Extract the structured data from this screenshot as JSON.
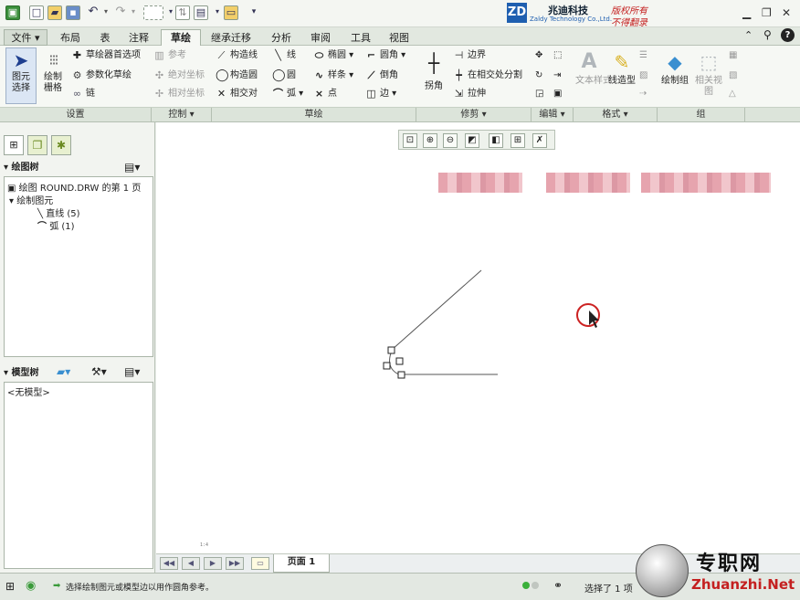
{
  "quick_access": {
    "icons": [
      "app-icon",
      "new-icon",
      "open-icon",
      "save-icon",
      "undo-icon",
      "redo-icon",
      "select-box-icon",
      "regen-icon",
      "window-icon",
      "folder-icon",
      "customize-icon"
    ]
  },
  "branding": {
    "company": "兆迪科技",
    "company_en": "Zaldy Technology Co.,Ltd.",
    "notice1": "版权所有",
    "notice2": "不得翻录",
    "logo_text": "ZD"
  },
  "tabs": [
    {
      "label": "文件"
    },
    {
      "label": "布局"
    },
    {
      "label": "表"
    },
    {
      "label": "注释"
    },
    {
      "label": "草绘"
    },
    {
      "label": "继承迁移"
    },
    {
      "label": "分析"
    },
    {
      "label": "审阅"
    },
    {
      "label": "工具"
    },
    {
      "label": "视图"
    }
  ],
  "ribbon": {
    "settings": {
      "select_label": "图元\n选择",
      "select_l1": "图元",
      "select_l2": "选择",
      "grid_l1": "绘制",
      "grid_l2": "栅格",
      "prefs": "草绘器首选项",
      "param": "参数化草绘",
      "chain": "链"
    },
    "control": {
      "ref": "参考",
      "abs_coord": "绝对坐标",
      "rel_coord": "相对坐标"
    },
    "sketch": {
      "const_line": "构造线",
      "const_circle": "构造圆",
      "intersect": "相交对",
      "line": "线",
      "circle": "圆",
      "arc": "弧",
      "ellipse": "椭圆",
      "spline": "样条",
      "point": "点",
      "fillet": "圆角",
      "chamfer": "倒角",
      "edge": "边"
    },
    "trim": {
      "corner": "拐角",
      "boundary": "边界",
      "split": "在相交处分割",
      "stretch": "拉伸"
    },
    "format": {
      "text_style": "文本样式",
      "line_style": "线造型"
    },
    "group": {
      "draw_group": "绘制组",
      "related_view": "相关视图"
    }
  },
  "groups": [
    {
      "label": "设置"
    },
    {
      "label": "控制 ▾"
    },
    {
      "label": "草绘"
    },
    {
      "label": "修剪 ▾"
    },
    {
      "label": "编辑 ▾"
    },
    {
      "label": "格式 ▾"
    },
    {
      "label": "组"
    }
  ],
  "drawing_tree": {
    "title": "绘图树",
    "root": "绘图 ROUND.DRW 的第 1 页",
    "sketched": "绘制图元",
    "line": "直线 (5)",
    "arc": "弧 (1)"
  },
  "model_tree": {
    "title": "模型树",
    "empty": "<无模型>"
  },
  "canvas": {
    "scale_text": "1:4"
  },
  "pagebar": {
    "page": "页面 1"
  },
  "status": {
    "message": "选择绘制图元或模型边以用作圆角参考。",
    "selected": "选择了 1 项"
  },
  "watermark": {
    "brand": "专职网",
    "url": "Zhuanzhi.Net"
  },
  "colors": {
    "accent": "#1f5fb0",
    "cursor_ring": "#cc2222",
    "watermark_red": "#c42020"
  }
}
